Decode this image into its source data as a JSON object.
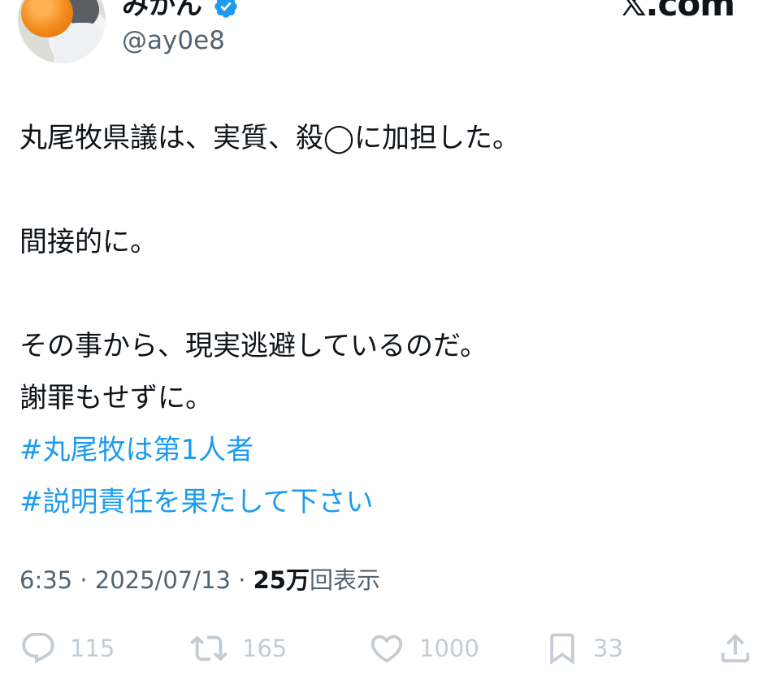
{
  "author": {
    "display_name": "みかん",
    "handle": "@ay0e8",
    "verified": true,
    "avatar_icon": "avatar-photo-orange"
  },
  "brand": {
    "text": "𝕏.com"
  },
  "tweet": {
    "lines": [
      "丸尾牧県議は、実質、殺◯に加担した。",
      "",
      "間接的に。",
      "",
      "その事から、現実逃避しているのだ。",
      "謝罪もせずに。"
    ],
    "hashtags": [
      "#丸尾牧は第1人者",
      "#説明責任を果たして下さい"
    ]
  },
  "meta": {
    "time": "6:35",
    "separator": " · ",
    "date": "2025/07/13",
    "views_number": "25万",
    "views_label": "回表示"
  },
  "actions": {
    "reply_count": "115",
    "repost_count": "165",
    "like_count": "1000",
    "bookmark_count": "33"
  },
  "colors": {
    "text": "#0f1419",
    "secondary": "#536471",
    "link": "#1d9bf0",
    "verified": "#1d9bf0",
    "action_faded": "#c4cbd1"
  }
}
